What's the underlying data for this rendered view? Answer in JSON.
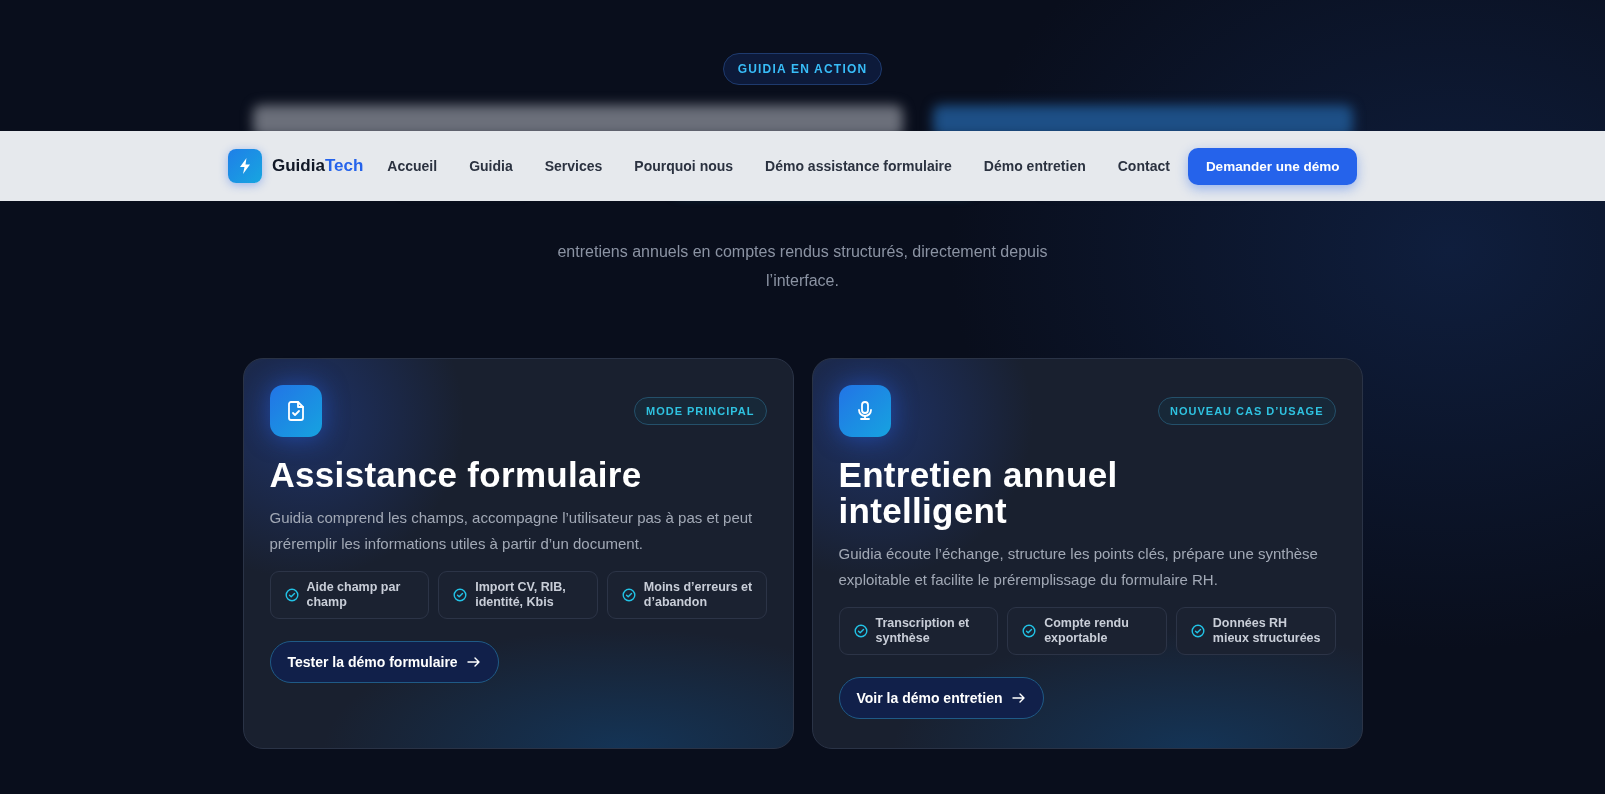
{
  "section_badge": "GUIDIA EN ACTION",
  "intro_lines": [
    "entretiens annuels en comptes rendus structurés, directement depuis",
    "l’interface."
  ],
  "navbar": {
    "brand": {
      "first": "Guidia",
      "second": "Tech"
    },
    "links": [
      "Accueil",
      "Guidia",
      "Services",
      "Pourquoi nous",
      "Démo assistance formulaire",
      "Démo entretien",
      "Contact"
    ],
    "cta": "Demander une démo"
  },
  "cards": [
    {
      "kind": "form",
      "badge": "MODE PRINCIPAL",
      "title": "Assistance formulaire",
      "description": "Guidia comprend les champs, accompagne l’utilisateur pas à pas et peut préremplir les informations utiles à partir d’un document.",
      "features": [
        "Aide champ par champ",
        "Import CV, RIB, identité, Kbis",
        "Moins d’erreurs et d’abandon"
      ],
      "button": "Tester la démo formulaire"
    },
    {
      "kind": "interview",
      "badge": "NOUVEAU CAS D’USAGE",
      "title": "Entretien annuel intelligent",
      "description": "Guidia écoute l’échange, structure les points clés, prépare une synthèse exploitable et facilite le préremplissage du formulaire RH.",
      "features": [
        "Transcription et synthèse",
        "Compte rendu exportable",
        "Données RH mieux structurées"
      ],
      "button": "Voir la démo entretien"
    }
  ]
}
